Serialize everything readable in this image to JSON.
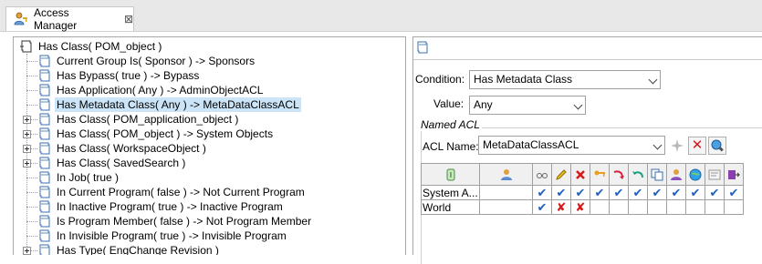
{
  "tab": {
    "icon": "user-key-icon",
    "title": "Access Manager",
    "close_icon": "close-icon"
  },
  "tree": {
    "root": {
      "label": "Has Class( POM_object )",
      "icon": "rule-node-icon"
    },
    "items": [
      {
        "label": "Current Group Is( Sponsor ) -> Sponsors",
        "expandable": false
      },
      {
        "label": "Has Bypass( true ) -> Bypass",
        "expandable": false
      },
      {
        "label": "Has Application( Any ) -> AdminObjectACL",
        "expandable": false
      },
      {
        "label": "Has Metadata Class( Any ) -> MetaDataClassACL",
        "expandable": false,
        "selected": true
      },
      {
        "label": "Has Class( POM_application_object )",
        "expandable": true
      },
      {
        "label": "Has Class( POM_object ) -> System Objects",
        "expandable": true
      },
      {
        "label": "Has Class( WorkspaceObject )",
        "expandable": true
      },
      {
        "label": "Has Class( SavedSearch )",
        "expandable": true
      },
      {
        "label": "In Job( true )",
        "expandable": false
      },
      {
        "label": "In Current Program( false ) -> Not Current Program",
        "expandable": false
      },
      {
        "label": "In Inactive Program( true ) -> Inactive Program",
        "expandable": false
      },
      {
        "label": "Is Program Member( false ) -> Not Program Member",
        "expandable": false
      },
      {
        "label": "In Invisible Program( true ) -> Invisible Program",
        "expandable": false
      },
      {
        "label": "Has Type( EngChange Revision )",
        "expandable": true
      }
    ]
  },
  "form": {
    "condition_label": "Condition:",
    "condition_value": "Has Metadata Class",
    "value_label": "Value:",
    "value_value": "Any",
    "named_acl_legend": "Named ACL",
    "acl_name_label": "ACL Name:",
    "acl_name_value": "MetaDataClassACL"
  },
  "acl_table": {
    "header_icons": [
      "accessor-type-icon",
      "accessor-id-icon",
      "read-icon",
      "write-icon",
      "delete-icon",
      "change-icon",
      "promote-icon",
      "demote-icon",
      "copy-icon",
      "change-ownership-icon",
      "publish-icon",
      "subscribe-icon",
      "export-icon"
    ],
    "rows": [
      {
        "accessor_type": "System A...",
        "accessor_id": "",
        "perms": [
          "check",
          "check",
          "check",
          "check",
          "check",
          "check",
          "check",
          "check",
          "check",
          "check",
          "check"
        ]
      },
      {
        "accessor_type": "World",
        "accessor_id": "",
        "perms": [
          "check",
          "cross",
          "cross",
          "",
          "",
          "",
          "",
          "",
          "",
          "",
          ""
        ]
      }
    ]
  },
  "colors": {
    "check": "#1f5fbf",
    "cross": "#d81818",
    "selection": "#cce4f7"
  }
}
